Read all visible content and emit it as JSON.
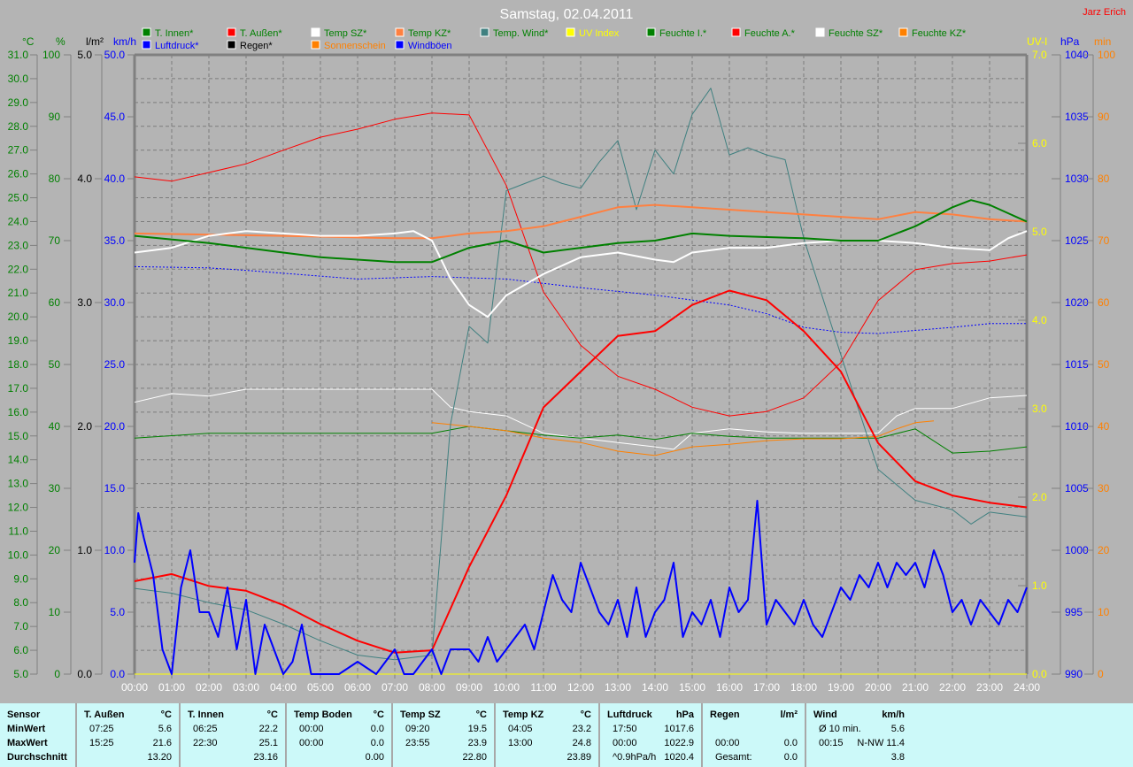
{
  "title": "Samstag, 02.04.2011",
  "author": "Jarz Erich",
  "legend": [
    {
      "label": "T. Innen*",
      "box": "#008000",
      "text": "#008000"
    },
    {
      "label": "T. Außen*",
      "box": "#ff0000",
      "text": "#008000"
    },
    {
      "label": "Temp SZ*",
      "box": "#ffffff",
      "text": "#008000"
    },
    {
      "label": "Temp KZ*",
      "box": "#ff8040",
      "text": "#008000"
    },
    {
      "label": "Temp. Wind*",
      "box": "#408080",
      "text": "#008000"
    },
    {
      "label": "UV Index",
      "box": "#ffff00",
      "text": "#ffff00"
    },
    {
      "label": "Feuchte I.*",
      "box": "#008000",
      "text": "#008000"
    },
    {
      "label": "Feuchte A.*",
      "box": "#ff0000",
      "text": "#008000"
    },
    {
      "label": "Feuchte SZ*",
      "box": "#ffffff",
      "text": "#008000"
    },
    {
      "label": "Feuchte KZ*",
      "box": "#ff8000",
      "text": "#008000"
    },
    {
      "label": "Luftdruck*",
      "box": "#0000ff",
      "text": "#0000ff"
    },
    {
      "label": "Regen*",
      "box": "#000000",
      "text": "#000000"
    },
    {
      "label": "Sonnenschein",
      "box": "#ff8000",
      "text": "#ff8000"
    },
    {
      "label": "Windböen",
      "box": "#0000ff",
      "text": "#0000ff"
    }
  ],
  "chart_data": {
    "type": "line",
    "title": "Samstag, 02.04.2011",
    "x_ticks": [
      "00:00",
      "01:00",
      "02:00",
      "03:00",
      "04:00",
      "05:00",
      "06:00",
      "07:00",
      "08:00",
      "09:00",
      "10:00",
      "11:00",
      "12:00",
      "13:00",
      "14:00",
      "15:00",
      "16:00",
      "17:00",
      "18:00",
      "19:00",
      "20:00",
      "21:00",
      "22:00",
      "23:00",
      "24:00"
    ],
    "grid": true,
    "axes": {
      "C": {
        "unit": "°C",
        "min": 5,
        "max": 31,
        "step": 1,
        "decimals": 1,
        "color": "#008000",
        "side": "left"
      },
      "pct": {
        "unit": "%",
        "min": 0,
        "max": 100,
        "step": 10,
        "decimals": 0,
        "color": "#008000",
        "side": "left"
      },
      "rain": {
        "unit": "l/m²",
        "min": 0,
        "max": 5,
        "step": 1,
        "decimals": 1,
        "color": "#000000",
        "side": "left"
      },
      "kmh": {
        "unit": "km/h",
        "min": 0,
        "max": 50,
        "step": 5,
        "decimals": 1,
        "color": "#0000ff",
        "side": "left"
      },
      "uv": {
        "unit": "UV-I",
        "min": 0,
        "max": 7,
        "step": 1,
        "decimals": 1,
        "color": "#ffff00",
        "side": "right"
      },
      "hPa": {
        "unit": "hPa",
        "min": 990,
        "max": 1040,
        "step": 5,
        "decimals": 0,
        "color": "#0000ff",
        "side": "right"
      },
      "min": {
        "unit": "min",
        "min": 0,
        "max": 100,
        "step": 10,
        "decimals": 0,
        "color": "#ff8000",
        "side": "right"
      }
    },
    "series": [
      {
        "name": "Feuchte A.",
        "axis": "pct",
        "color": "#ff0000",
        "width": 1,
        "x": [
          0,
          1,
          2,
          3,
          4,
          5,
          6,
          7,
          8,
          9,
          10,
          11,
          12,
          13,
          14,
          15,
          16,
          17,
          18,
          19,
          20,
          21,
          22,
          23,
          24
        ],
        "y": [
          80.3,
          79.6,
          81,
          82.4,
          84.6,
          86.7,
          88,
          89.6,
          90.6,
          90.3,
          78.9,
          61.7,
          53.1,
          48.1,
          46,
          43.1,
          41.7,
          42.4,
          44.6,
          50.3,
          60.3,
          65.3,
          66.3,
          66.7,
          67.7
        ]
      },
      {
        "name": "Feuchte SZ",
        "axis": "pct",
        "color": "#ffffff",
        "width": 1,
        "x": [
          0,
          1,
          2,
          3,
          6,
          8,
          8.5,
          9,
          10,
          11,
          12,
          13,
          14,
          14.5,
          15,
          16,
          17,
          18,
          19,
          20,
          20.5,
          21,
          22,
          23,
          24
        ],
        "y": [
          43.9,
          45.3,
          44.9,
          46,
          46,
          46,
          43.1,
          42.4,
          41.7,
          38.9,
          38.1,
          37.4,
          36.7,
          36.3,
          38.9,
          39.6,
          39.1,
          38.9,
          38.9,
          38.9,
          41.7,
          42.9,
          42.9,
          44.6,
          45
        ]
      },
      {
        "name": "Feuchte I.",
        "axis": "pct",
        "color": "#008000",
        "width": 1,
        "x": [
          0,
          2,
          5,
          8,
          9,
          10,
          11,
          12,
          13,
          14,
          15,
          16,
          17,
          19,
          20,
          21,
          22,
          23,
          24
        ],
        "y": [
          38.1,
          38.9,
          38.9,
          38.9,
          40,
          39.3,
          38.6,
          38.1,
          38.6,
          37.9,
          38.9,
          38.4,
          38.1,
          38.1,
          38.1,
          39.6,
          35.7,
          36,
          36.7
        ]
      },
      {
        "name": "Feuchte KZ",
        "axis": "pct",
        "color": "#ff8000",
        "width": 1,
        "x": [
          8,
          9,
          10,
          11,
          12,
          13,
          14,
          15,
          16,
          17,
          18,
          19,
          20,
          20.5,
          21,
          21.5
        ],
        "y": [
          40.6,
          40,
          39.3,
          38.1,
          37.4,
          36,
          35.3,
          36.7,
          37.1,
          37.7,
          38,
          38,
          38.4,
          39.6,
          40.6,
          40.9
        ]
      },
      {
        "name": "Luftdruck",
        "axis": "hPa",
        "color": "#0000ff",
        "width": 1,
        "dash": "2,2",
        "x": [
          0,
          2,
          3,
          6,
          8,
          10,
          12,
          14,
          16,
          17,
          18,
          19,
          20,
          22,
          23,
          24
        ],
        "y": [
          1022.9,
          1022.8,
          1022.6,
          1021.9,
          1022.1,
          1021.9,
          1021.2,
          1020.6,
          1019.8,
          1019.1,
          1018,
          1017.6,
          1017.5,
          1018,
          1018.3,
          1018.3
        ]
      },
      {
        "name": "Temp. Wind",
        "axis": "C",
        "color": "#408080",
        "width": 1,
        "x": [
          0,
          1,
          2,
          3,
          4,
          5,
          6,
          7,
          8,
          8.5,
          9,
          9.5,
          10,
          10.5,
          11,
          11.5,
          12,
          12.5,
          13,
          13.5,
          14,
          14.5,
          15,
          15.5,
          16,
          16.5,
          17,
          17.5,
          18,
          19,
          20,
          21,
          22,
          22.5,
          23,
          24
        ],
        "y": [
          8.6,
          8.4,
          8,
          7.7,
          7.1,
          6.4,
          5.8,
          5.6,
          5.8,
          15.5,
          19.6,
          18.9,
          25.3,
          25.6,
          25.9,
          25.6,
          25.4,
          26.5,
          27.4,
          24.5,
          27,
          26,
          28.5,
          29.6,
          26.8,
          27.1,
          26.8,
          26.6,
          23.3,
          18.4,
          13.6,
          12.3,
          11.9,
          11.3,
          11.8,
          11.6
        ]
      },
      {
        "name": "Temp KZ",
        "axis": "C",
        "color": "#ff8040",
        "width": 2,
        "x": [
          0,
          4,
          7,
          8,
          9,
          10,
          11,
          12,
          13,
          14,
          15,
          16,
          17,
          18,
          19,
          20,
          21,
          22,
          23,
          24
        ],
        "y": [
          23.5,
          23.4,
          23.3,
          23.3,
          23.5,
          23.6,
          23.8,
          24.2,
          24.6,
          24.7,
          24.6,
          24.5,
          24.4,
          24.3,
          24.2,
          24.1,
          24.4,
          24.3,
          24.1,
          24
        ]
      },
      {
        "name": "Temp SZ",
        "axis": "C",
        "color": "#ffffff",
        "width": 2,
        "x": [
          0,
          1,
          2,
          3,
          4,
          5,
          6,
          7,
          7.5,
          8,
          8.5,
          9,
          9.5,
          10,
          11,
          12,
          13,
          14,
          14.5,
          15,
          16,
          17,
          18,
          19,
          20,
          21,
          22,
          23,
          23.5,
          24
        ],
        "y": [
          22.7,
          22.9,
          23.4,
          23.6,
          23.5,
          23.4,
          23.4,
          23.5,
          23.6,
          23.2,
          21.6,
          20.5,
          20,
          20.9,
          21.8,
          22.5,
          22.7,
          22.4,
          22.3,
          22.7,
          22.9,
          22.9,
          23.1,
          23.2,
          23.2,
          23.1,
          22.9,
          22.8,
          23.3,
          23.6
        ]
      },
      {
        "name": "T. Innen",
        "axis": "C",
        "color": "#008000",
        "width": 2,
        "x": [
          0,
          2,
          4,
          5,
          7,
          8,
          9,
          10,
          11,
          12,
          13,
          14,
          15,
          16,
          18,
          19,
          20,
          21,
          22,
          22.5,
          23,
          24
        ],
        "y": [
          23.4,
          23.1,
          22.7,
          22.5,
          22.3,
          22.3,
          22.9,
          23.2,
          22.7,
          22.9,
          23.1,
          23.2,
          23.5,
          23.4,
          23.3,
          23.2,
          23.2,
          23.8,
          24.6,
          24.9,
          24.7,
          24
        ]
      },
      {
        "name": "T. Außen",
        "axis": "C",
        "color": "#ff0000",
        "width": 2,
        "x": [
          0,
          1,
          2,
          3,
          4,
          5,
          6,
          7,
          8,
          9,
          10,
          11,
          12,
          13,
          14,
          15,
          16,
          17,
          18,
          19,
          20,
          21,
          22,
          23,
          24
        ],
        "y": [
          8.9,
          9.2,
          8.7,
          8.5,
          7.9,
          7.1,
          6.4,
          5.9,
          6,
          9.5,
          12.5,
          16.2,
          17.7,
          19.2,
          19.4,
          20.5,
          21.1,
          20.7,
          19.4,
          17.7,
          14.7,
          13.1,
          12.5,
          12.2,
          12
        ]
      },
      {
        "name": "UV Index",
        "axis": "uv",
        "color": "#ffff00",
        "width": 1,
        "x": [
          0,
          24
        ],
        "y": [
          0,
          0
        ]
      },
      {
        "name": "Windböen",
        "axis": "kmh",
        "color": "#0000ff",
        "width": 2,
        "x": [
          0,
          0.1,
          0.25,
          0.5,
          0.75,
          1,
          1.25,
          1.5,
          1.75,
          2,
          2.25,
          2.5,
          2.75,
          3,
          3.25,
          3.5,
          3.75,
          4,
          4.25,
          4.5,
          4.75,
          5,
          5.5,
          6,
          6.5,
          7,
          7.25,
          7.5,
          8,
          8.25,
          8.5,
          9,
          9.25,
          9.5,
          9.75,
          10,
          10.25,
          10.5,
          10.75,
          11,
          11.25,
          11.5,
          11.75,
          12,
          12.25,
          12.5,
          12.75,
          13,
          13.25,
          13.5,
          13.75,
          14,
          14.25,
          14.5,
          14.75,
          15,
          15.25,
          15.5,
          15.75,
          16,
          16.25,
          16.5,
          16.75,
          17,
          17.25,
          17.5,
          17.75,
          18,
          18.25,
          18.5,
          18.75,
          19,
          19.25,
          19.5,
          19.75,
          20,
          20.25,
          20.5,
          20.75,
          21,
          21.25,
          21.5,
          21.75,
          22,
          22.25,
          22.5,
          22.75,
          23,
          23.25,
          23.5,
          23.75,
          24
        ],
        "y": [
          9,
          13,
          11,
          8,
          2,
          0,
          7,
          10,
          5,
          5,
          3,
          7,
          2,
          6,
          0,
          4,
          2,
          0,
          1,
          4,
          0,
          0,
          0,
          1,
          0,
          2,
          0,
          0,
          2,
          0,
          2,
          2,
          1,
          3,
          1,
          2,
          3,
          4,
          2,
          5,
          8,
          6,
          5,
          9,
          7,
          5,
          4,
          6,
          3,
          7,
          3,
          5,
          6,
          9,
          3,
          5,
          4,
          6,
          3,
          7,
          5,
          6,
          14,
          4,
          6,
          5,
          4,
          6,
          4,
          3,
          5,
          7,
          6,
          8,
          7,
          9,
          7,
          9,
          8,
          9,
          7,
          10,
          8,
          5,
          6,
          4,
          6,
          5,
          4,
          6,
          5,
          7
        ]
      }
    ]
  },
  "stats": {
    "columns": [
      {
        "header": "Sensor",
        "unit": "",
        "rows": [
          {
            "a": "MinWert",
            "b": ""
          },
          {
            "a": "MaxWert",
            "b": ""
          },
          {
            "a": "Durchschnitt",
            "b": ""
          }
        ]
      },
      {
        "header": "T. Außen",
        "unit": "°C",
        "rows": [
          {
            "a": "07:25",
            "b": "5.6"
          },
          {
            "a": "15:25",
            "b": "21.6"
          },
          {
            "a": "",
            "b": "13.20"
          }
        ]
      },
      {
        "header": "T. Innen",
        "unit": "°C",
        "rows": [
          {
            "a": "06:25",
            "b": "22.2"
          },
          {
            "a": "22:30",
            "b": "25.1"
          },
          {
            "a": "",
            "b": "23.16"
          }
        ]
      },
      {
        "header": "Temp Boden",
        "unit": "°C",
        "rows": [
          {
            "a": "00:00",
            "b": "0.0"
          },
          {
            "a": "00:00",
            "b": "0.0"
          },
          {
            "a": "",
            "b": "0.00"
          }
        ]
      },
      {
        "header": "Temp SZ",
        "unit": "°C",
        "rows": [
          {
            "a": "09:20",
            "b": "19.5"
          },
          {
            "a": "23:55",
            "b": "23.9"
          },
          {
            "a": "",
            "b": "22.80"
          }
        ]
      },
      {
        "header": "Temp KZ",
        "unit": "°C",
        "rows": [
          {
            "a": "04:05",
            "b": "23.2"
          },
          {
            "a": "13:00",
            "b": "24.8"
          },
          {
            "a": "",
            "b": "23.89"
          }
        ]
      },
      {
        "header": "Luftdruck",
        "unit": "hPa",
        "rows": [
          {
            "a": "17:50",
            "b": "1017.6"
          },
          {
            "a": "00:00",
            "b": "1022.9"
          },
          {
            "a": "^0.9hPa/h",
            "b": "1020.4"
          }
        ]
      },
      {
        "header": "Regen",
        "unit": "l/m²",
        "rows": [
          {
            "a": "",
            "b": ""
          },
          {
            "a": "00:00",
            "b": "0.0"
          },
          {
            "a": "Gesamt:",
            "b": "0.0"
          }
        ]
      },
      {
        "header": "Wind",
        "unit": "km/h",
        "rows": [
          {
            "a": "Ø 10 min.",
            "b": "5.6"
          },
          {
            "a": "00:15",
            "b": "N-NW 11.4"
          },
          {
            "a": "",
            "b": "3.8"
          }
        ]
      }
    ]
  }
}
